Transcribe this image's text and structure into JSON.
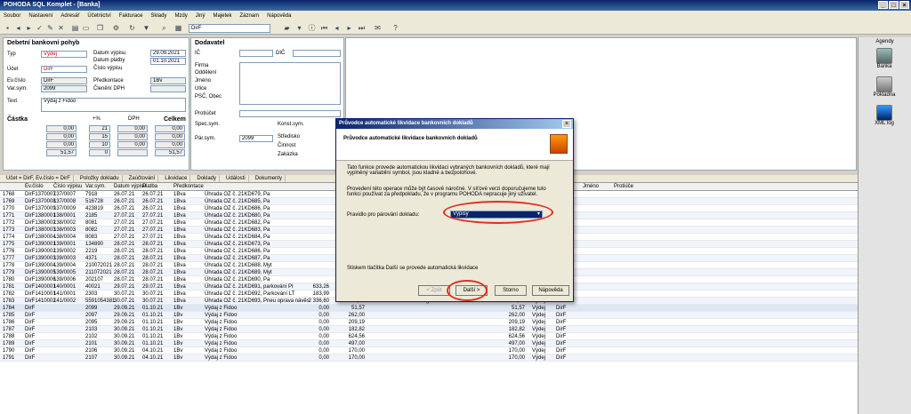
{
  "window": {
    "title": "POHODA SQL Komplet - [Banka]"
  },
  "menu": [
    "Soubor",
    "Nastavení",
    "Adresář",
    "Účetnictví",
    "Fakturace",
    "Sklady",
    "Mzdy",
    "Jiný",
    "Majetek",
    "Záznam",
    "Nápověda"
  ],
  "toolbar": {
    "filter_value": "DirF"
  },
  "form": {
    "section_title": "Debetní bankovní pohyb",
    "typ_label": "Typ",
    "typ_value": "Výdej",
    "datum_vypisu_label": "Datum výpisu",
    "datum_vypisu": "29.09.2021",
    "datum_platby_label": "Datum platby",
    "datum_platby": "01.10.2021",
    "cislo_vypisu_label": "Číslo výpisu",
    "ucet_label": "Účet",
    "ucet_value": "DirF",
    "evcislo_label": "Ev.číslo",
    "evcislo_value": "DirF",
    "predkontace_label": "Předkontace",
    "predkontace_value": "1Bv",
    "varsym_label": "Var.sym.",
    "varsym_value": "2099",
    "cleneni_label": "Členění DPH",
    "text_label": "Text",
    "text_value": "Výdaj z Fidoo",
    "castka_label": "Částka",
    "pct_label": "+%",
    "dph_label": "DPH",
    "celkem_label": "Celkem",
    "rows": [
      [
        "0,00",
        "21",
        "0,00",
        "0,00"
      ],
      [
        "0,00",
        "15",
        "0,00",
        "0,00"
      ],
      [
        "0,00",
        "10",
        "0,00",
        "0,00"
      ],
      [
        "51,57",
        "0",
        "",
        "51,57"
      ]
    ]
  },
  "dodavatel": {
    "title": "Dodavatel",
    "ic_label": "IČ",
    "dic_label": "DIČ",
    "firma_label": "Firma",
    "oddeleni_label": "Oddělení",
    "jmeno_label": "Jméno",
    "ulice_label": "Ulice",
    "psc_label": "PSČ, Obec",
    "protiucet_label": "Protiúčet",
    "spec_label": "Spec.sym.",
    "konst_label": "Konst.sym.",
    "par_label": "Pár.sym.",
    "par_value": "2099",
    "stredisko_label": "Středisko",
    "cinnost_label": "Činnost",
    "zakazka_label": "Zakázka"
  },
  "grid_tabs": [
    "Účet = DirF, Ev.číslo = DirF",
    "Položky dokladu",
    "Zaúčtování",
    "Likvidace",
    "Doklady",
    "Události",
    "Dokumenty"
  ],
  "columns": [
    "Ev.číslo",
    "Číslo výpisu",
    "Var.sym.",
    "Datum výpisu",
    "Platba",
    "Předkontace",
    "",
    "",
    "",
    "",
    "Firma",
    "Celkem",
    "Typ",
    "Účet",
    "Jméno",
    "Protiúče"
  ],
  "rows": [
    [
      "1768",
      "DirF1370007",
      "137/0007",
      "7918",
      "26.07.21",
      "26.07.21",
      "1Bva",
      "Úhrada OZ č. 21KD679, Pa",
      "",
      "",
      "Swiss bar",
      "115,35",
      "Výdej",
      "DirF",
      ""
    ],
    [
      "1769",
      "DirF1370008",
      "137/0008",
      "516728",
      "26.07.21",
      "26.07.21",
      "1Bva",
      "Úhrada OZ č. 21KD685, Pa",
      "",
      "",
      "UAB Pakeles namai",
      "131,21",
      "Výdej",
      "DirF",
      ""
    ],
    [
      "1770",
      "DirF1370009",
      "137/0009",
      "423819",
      "26.07.21",
      "26.07.21",
      "1Bva",
      "Úhrada OZ č. 21KD686, Pa",
      "",
      "",
      "GITD M3K",
      "1 188,12",
      "Výdej",
      "DirF",
      ""
    ],
    [
      "1771",
      "DirF1380001",
      "138/0001",
      "2185",
      "27.07.21",
      "27.07.21",
      "1Bva",
      "Úhrada OZ č. 21KD680, Pa",
      "",
      "",
      "UAB Bogruva",
      "183,69",
      "Výdej",
      "DirF",
      ""
    ],
    [
      "1772",
      "DirF1380002",
      "138/0002",
      "8081",
      "27.07.21",
      "27.07.21",
      "1Bva",
      "Úhrada OZ č. 21KD682, Pa",
      "",
      "",
      "Swiss bar",
      "115,35",
      "Výdej",
      "DirF",
      ""
    ],
    [
      "1773",
      "DirF1380003",
      "138/0003",
      "8082",
      "27.07.21",
      "27.07.21",
      "1Bva",
      "Úhrada OZ č. 21KD683, Pa",
      "",
      "",
      "Swiss bar",
      "115,35",
      "Výdej",
      "DirF",
      ""
    ],
    [
      "1774",
      "DirF1380004",
      "138/0004",
      "8083",
      "27.07.21",
      "27.07.21",
      "1Bva",
      "Úhrada OZ č. 21KD684, Pa",
      "",
      "",
      "Swiss bar",
      "115,35",
      "Výdej",
      "DirF",
      ""
    ],
    [
      "1775",
      "DirF1390001",
      "139/0001",
      "134890",
      "28.07.21",
      "28.07.21",
      "1Bva",
      "Úhrada OZ č. 21KD673, Pa",
      "",
      "",
      "OKQ8",
      "115,35",
      "Výdej",
      "DirF",
      ""
    ],
    [
      "1776",
      "DirF1390002",
      "139/0002",
      "2219",
      "28.07.21",
      "28.07.21",
      "1Bva",
      "Úhrada OZ č. 21KD686, Pa",
      "",
      "",
      "UAB Bogruva",
      "183,69",
      "Výdej",
      "DirF",
      ""
    ],
    [
      "1777",
      "DirF1390003",
      "139/0003",
      "4371",
      "28.07.21",
      "28.07.21",
      "1Bva",
      "Úhrada OZ č. 21KD687, Pa",
      "",
      "",
      "Trnavská NAD, a.s.",
      "131,39",
      "Výdej",
      "DirF",
      ""
    ],
    [
      "1778",
      "DirF1390004",
      "139/0004",
      "210072021",
      "28.07.21",
      "28.07.21",
      "1Bva",
      "Úhrada OZ č. 21KD688, Myt",
      "",
      "",
      "Zaklad Uslg HYDRO",
      "748,39",
      "Výdej",
      "DirF",
      ""
    ],
    [
      "1779",
      "DirF1390005",
      "139/0005",
      "211072021",
      "28.07.21",
      "28.07.21",
      "1Bva",
      "Úhrada OZ č. 21KD689, Myt",
      "",
      "",
      "Zaklad Uslg HYDRO",
      "748,39",
      "Výdej",
      "DirF",
      ""
    ],
    [
      "1780",
      "DirF1390006",
      "139/0006",
      "202107",
      "28.07.21",
      "28.07.21",
      "1Bva",
      "Úhrada OZ č. 21KD690, Pa",
      "",
      "",
      "Stacja paliw neo",
      "86,35",
      "Výdej",
      "DirF",
      ""
    ],
    [
      "1781",
      "DirF1400001",
      "140/0001",
      "40021",
      "29.07.21",
      "29.07.21",
      "1Bva",
      "Úhrada OZ č. 21KD691, parkování PI",
      "633,26",
      "0,00",
      "PPHU Rico",
      "633,26",
      "Výdej",
      "DirF",
      ""
    ],
    [
      "1782",
      "DirF1410001",
      "141/0001",
      "2303",
      "30.07.21",
      "30.07.21",
      "1Bva",
      "Úhrada OZ č. 21KD692, Parkování LT",
      "183,99",
      "0,00",
      "UAB Bogruva",
      "183,99",
      "Výdej",
      "DirF",
      ""
    ],
    [
      "1783",
      "DirF1410002",
      "141/0002",
      "5591054381",
      "30.07.21",
      "30.07.21",
      "1Bva",
      "Úhrada OZ č. 21KD693, Pneu oprava návěs",
      "2 336,60",
      "0,00",
      "Ringcentralen",
      "2 336,60",
      "Výdej",
      "DirF",
      ""
    ],
    [
      "1784",
      "DirF",
      "",
      "2099",
      "29.09.21",
      "01.10.21",
      "1Bv",
      "Výdaj z Fidoo",
      "0,00",
      "51,57",
      "",
      "51,57",
      "Výdej",
      "DirF",
      ""
    ],
    [
      "1785",
      "DirF",
      "",
      "2097",
      "29.09.21",
      "01.10.21",
      "1Bv",
      "Výdaj z Fidoo",
      "0,00",
      "262,00",
      "",
      "262,00",
      "Výdej",
      "DirF",
      ""
    ],
    [
      "1786",
      "DirF",
      "",
      "2095",
      "29.09.21",
      "01.10.21",
      "1Bv",
      "Výdaj z Fidoo",
      "0,00",
      "209,19",
      "",
      "209,19",
      "Výdej",
      "DirF",
      ""
    ],
    [
      "1787",
      "DirF",
      "",
      "2103",
      "30.09.21",
      "01.10.21",
      "1Bv",
      "Výdaj z Fidoo",
      "0,00",
      "182,82",
      "",
      "182,82",
      "Výdej",
      "DirF",
      ""
    ],
    [
      "1788",
      "DirF",
      "",
      "2102",
      "30.09.21",
      "01.10.21",
      "1Bv",
      "Výdaj z Fidoo",
      "0,00",
      "624,56",
      "",
      "624,56",
      "Výdej",
      "DirF",
      ""
    ],
    [
      "1789",
      "DirF",
      "",
      "2101",
      "30.09.21",
      "01.10.21",
      "1Bv",
      "Výdaj z Fidoo",
      "0,00",
      "497,00",
      "",
      "497,00",
      "Výdej",
      "DirF",
      ""
    ],
    [
      "1790",
      "DirF",
      "",
      "2106",
      "30.09.21",
      "04.10.21",
      "1Bv",
      "Výdaj z Fidoo",
      "0,00",
      "170,00",
      "",
      "170,00",
      "Výdej",
      "DirF",
      ""
    ],
    [
      "1791",
      "DirF",
      "",
      "2107",
      "30.09.21",
      "04.10.21",
      "1Bv",
      "Výdaj z Fidoo",
      "0,00",
      "170,00",
      "",
      "170,00",
      "Výdej",
      "DirF",
      ""
    ]
  ],
  "agenda": {
    "title": "Agendy",
    "items": [
      "Banka",
      "Pokladna",
      "XML log"
    ]
  },
  "dialog": {
    "title": "Průvodce automatické likvidace bankovních dokladů",
    "heading": "Průvodce automatické likvidace bankovních dokladů",
    "para1": "Tato funkce provede automatickou likvidaci vybraných bankovních dokladů, které mají vyplněný variabilní symbol, jsou kladné a bezpolohové.",
    "para2": "Provedení této operace může být časově náročné. V síťové verzi doporučujeme tuto funkci používat za předpokladu, že v programu POHODA nepracuje jiný uživatel.",
    "rule_label": "Pravidlo pro párování dokladu:",
    "rule_value": "Výpisy",
    "hint": "Stiskem tlačítka Další se provede automatická likvidace",
    "btn_back": "< Zpět",
    "btn_next": "Další >",
    "btn_cancel": "Storno",
    "btn_help": "Nápověda"
  },
  "colors": {
    "title_bar": "#0a246a",
    "highlight": "#e0301e",
    "selected_row": "#dde6f3"
  }
}
